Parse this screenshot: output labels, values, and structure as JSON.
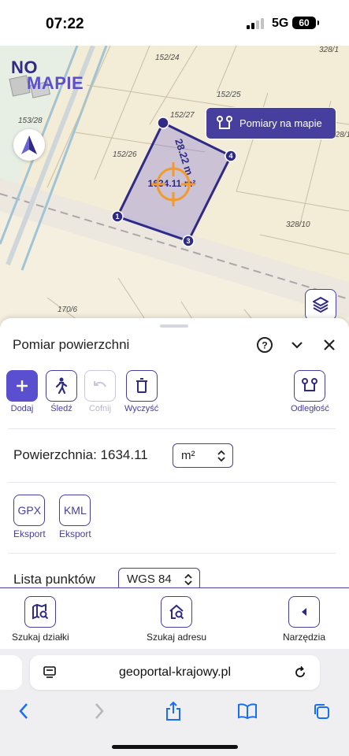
{
  "status_bar": {
    "time": "07:22",
    "network": "5G",
    "battery": "60"
  },
  "map": {
    "logo_top": "NO",
    "logo_bottom": "MAPIE",
    "measure_button_label": "Pomiary na mapie",
    "parcel_labels": [
      "152/24",
      "152/25",
      "152/26",
      "152/27",
      "153/28",
      "328/1",
      "328/10",
      "170/6",
      "28"
    ],
    "side_length_label": "28.22 m",
    "area_label": "1634.11 m²",
    "vertex_labels": [
      "1",
      "2",
      "3",
      "4"
    ],
    "accent_color": "#463f9e"
  },
  "panel": {
    "title": "Pomiar powierzchni",
    "tools": {
      "add": "Dodaj",
      "track": "Śledź",
      "undo": "Cofnij",
      "clear": "Wyczyść",
      "distance": "Odległość"
    },
    "area": {
      "label": "Powierzchnia: 1634.11",
      "unit": "m²"
    },
    "exports": [
      {
        "format": "GPX",
        "label": "Eksport"
      },
      {
        "format": "KML",
        "label": "Eksport"
      }
    ],
    "points": {
      "label": "Lista punktów",
      "crs": "WGS 84"
    }
  },
  "bottom_nav": {
    "search_parcel": "Szukaj działki",
    "search_address": "Szukaj adresu",
    "tools": "Narzędzia"
  },
  "browser": {
    "url": "geoportal-krajowy.pl"
  }
}
